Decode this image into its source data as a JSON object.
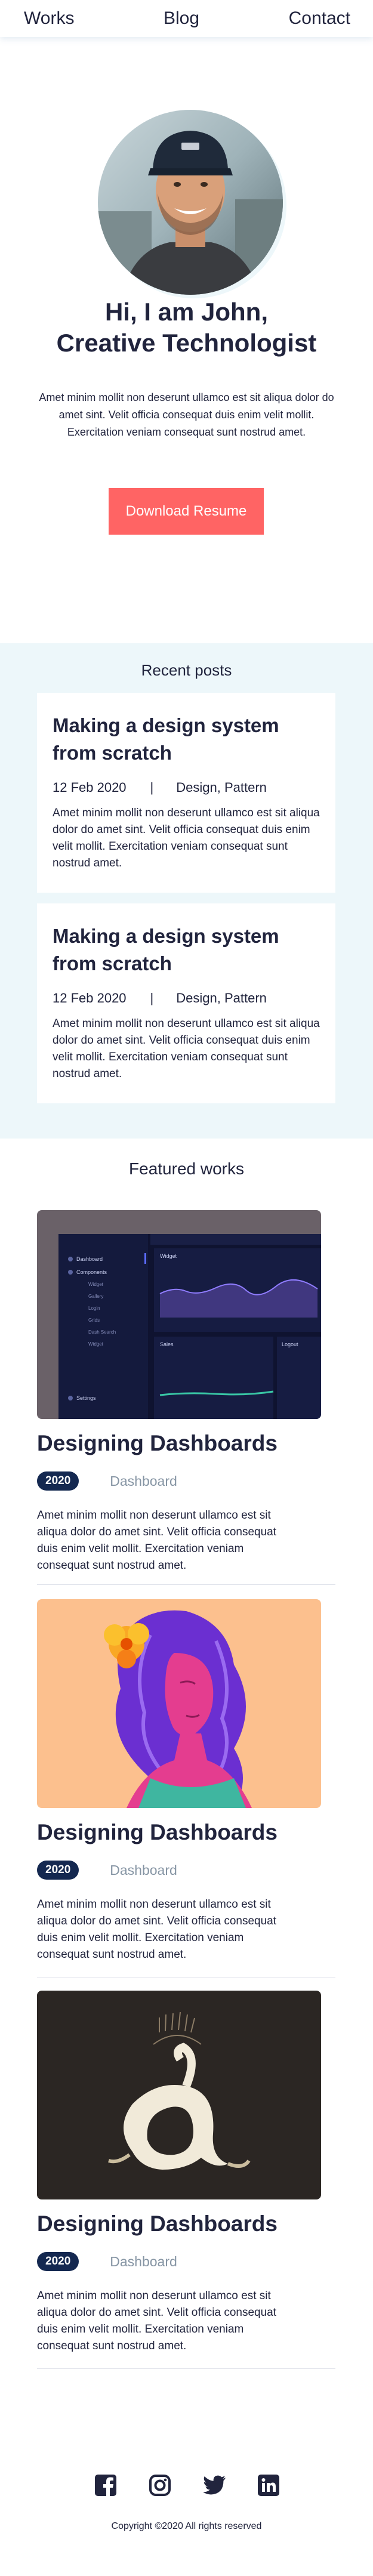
{
  "nav": {
    "works": "Works",
    "blog": "Blog",
    "contact": "Contact"
  },
  "hero": {
    "title_line1": "Hi, I am John,",
    "title_line2": "Creative Technologist",
    "description": "Amet minim mollit non deserunt ullamco est sit aliqua dolor do amet sint. Velit officia consequat duis enim velit mollit. Exercitation veniam consequat sunt nostrud amet.",
    "cta": "Download Resume"
  },
  "recent_posts": {
    "heading": "Recent posts",
    "items": [
      {
        "title": "Making a design system from scratch",
        "date": "12 Feb 2020",
        "separator": "|",
        "tags": "Design, Pattern",
        "excerpt": "Amet minim mollit non deserunt ullamco est sit aliqua dolor do amet sint. Velit officia consequat duis enim velit mollit. Exercitation veniam consequat sunt nostrud amet."
      },
      {
        "title": "Making a design system from scratch",
        "date": "12 Feb 2020",
        "separator": "|",
        "tags": "Design, Pattern",
        "excerpt": "Amet minim mollit non deserunt ullamco est sit aliqua dolor do amet sint. Velit officia consequat duis enim velit mollit. Exercitation veniam consequat sunt nostrud amet."
      }
    ]
  },
  "featured_works": {
    "heading": "Featured works",
    "items": [
      {
        "title": "Designing Dashboards",
        "year": "2020",
        "category": "Dashboard",
        "description": "Amet minim mollit non deserunt ullamco est sit aliqua dolor do amet sint. Velit officia consequat duis enim velit mollit. Exercitation veniam consequat sunt nostrud amet.",
        "image": "dashboard-screenshot",
        "dashboard_menu": [
          "Dashboard",
          "Components",
          "Widget",
          "Gallery",
          "Login",
          "Grids",
          "Dash Search",
          "Widget",
          "Settings"
        ],
        "dashboard_tiles": [
          "Widget",
          "Sales",
          "Logout"
        ]
      },
      {
        "title": "Designing Dashboards",
        "year": "2020",
        "category": "Dashboard",
        "description": "Amet minim mollit non deserunt ullamco est sit aliqua dolor do amet sint. Velit officia consequat duis enim velit mollit. Exercitation veniam consequat sunt nostrud amet.",
        "image": "woman-illustration"
      },
      {
        "title": "Designing Dashboards",
        "year": "2020",
        "category": "Dashboard",
        "description": "Amet minim mollit non deserunt ullamco est sit aliqua dolor do amet sint. Velit officia consequat duis enim velit mollit. Exercitation veniam consequat sunt nostrud amet.",
        "image": "letter-a-typography"
      }
    ]
  },
  "footer": {
    "socials": [
      "facebook-icon",
      "instagram-icon",
      "twitter-icon",
      "linkedin-icon"
    ],
    "copyright": "Copyright ©2020 All rights reserved"
  },
  "colors": {
    "primary_text": "#21243D",
    "accent": "#FF6464",
    "section_bg": "#EDF7FA",
    "badge_bg": "#142850",
    "muted": "#8695A4"
  }
}
